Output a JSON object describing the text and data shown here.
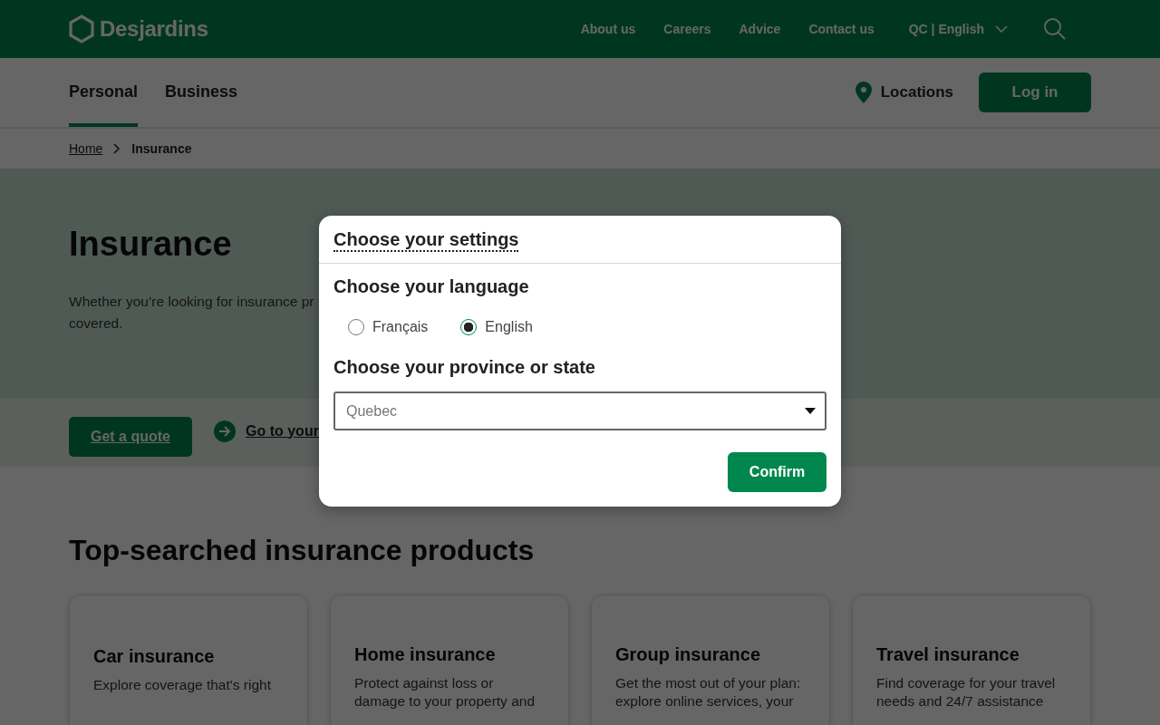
{
  "header": {
    "logo": "Desjardins",
    "links": [
      "About us",
      "Careers",
      "Advice",
      "Contact us"
    ],
    "region_language": "QC | English"
  },
  "nav": {
    "tabs": [
      {
        "label": "Personal",
        "selected": true
      },
      {
        "label": "Business",
        "selected": false
      }
    ],
    "locations": "Locations",
    "login": "Log in"
  },
  "breadcrumb": {
    "home": "Home",
    "current": "Insurance"
  },
  "hero": {
    "title": "Insurance",
    "text_line_1": "Whether you’re looking for insurance pr",
    "text_line_2": "covered."
  },
  "actions": {
    "quote": "Get a quote",
    "link": "Go to your"
  },
  "products": {
    "title": "Top-searched insurance products",
    "cards": [
      {
        "title": "Car insurance",
        "text": "Explore coverage that's right"
      },
      {
        "title": "Home insurance",
        "text": "Protect against loss or",
        "text_2": "damage to your property and"
      },
      {
        "title": "Group insurance",
        "text": "Get the most out of your plan:",
        "text_2": "explore online services, your"
      },
      {
        "title": "Travel insurance",
        "text": "Find coverage for your travel",
        "text_2": "needs and 24/7 assistance"
      }
    ]
  },
  "dialog": {
    "title": "Choose your settings",
    "language_heading": "Choose your language",
    "languages": [
      {
        "label": "Français",
        "selected": false
      },
      {
        "label": "English",
        "selected": true
      }
    ],
    "province_heading": "Choose your province or state",
    "province": "Quebec",
    "confirm": "Confirm"
  }
}
